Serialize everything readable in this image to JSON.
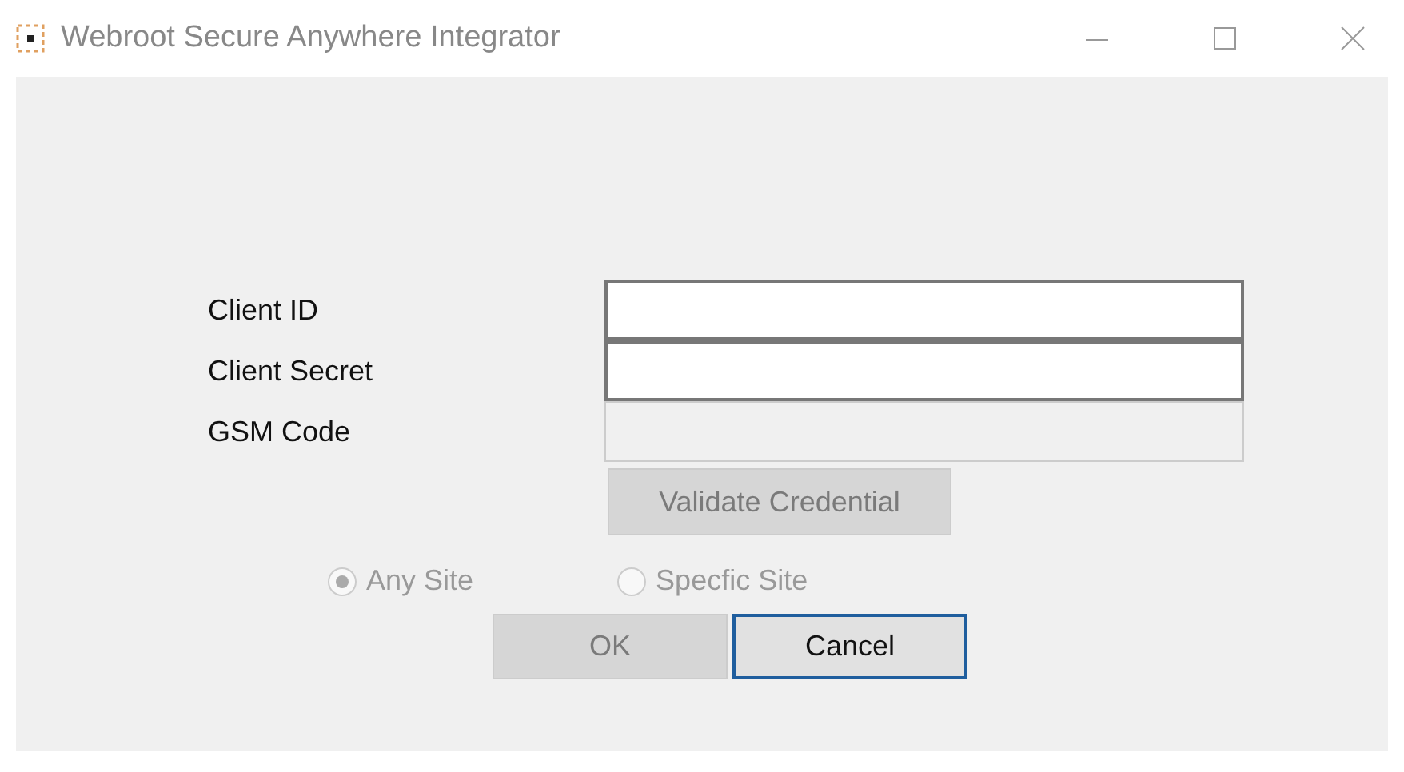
{
  "window": {
    "title": "Webroot Secure Anywhere Integrator"
  },
  "fields": [
    {
      "label": "Client ID",
      "disabled": false
    },
    {
      "label": "Client Secret",
      "disabled": false
    },
    {
      "label": "GSM Code",
      "disabled": true
    }
  ],
  "validate_button": {
    "label": "Validate Credential",
    "disabled": true
  },
  "radios": [
    {
      "label": "Any Site",
      "selected": true,
      "disabled": true
    },
    {
      "label": "Specfic Site",
      "selected": false,
      "disabled": true
    }
  ],
  "buttons": [
    {
      "label": "OK",
      "disabled": true,
      "focused": false
    },
    {
      "label": "Cancel",
      "disabled": false,
      "focused": true
    }
  ]
}
